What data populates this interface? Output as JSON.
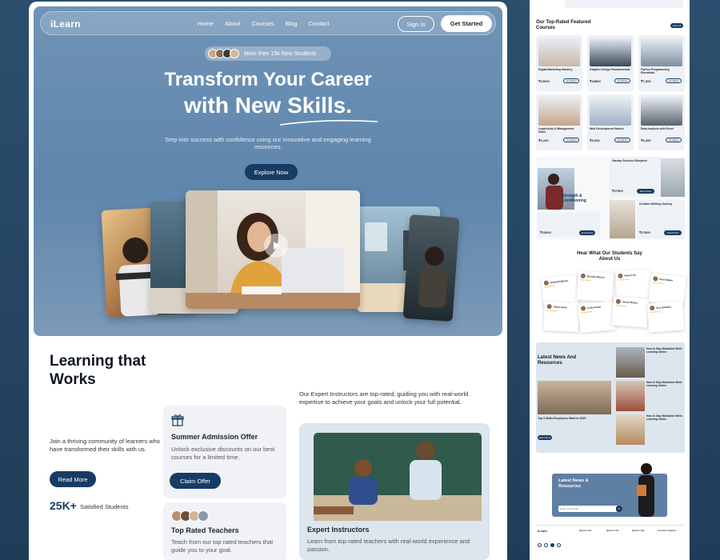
{
  "nav": {
    "logo": "iLearn",
    "links": [
      "Home",
      "About",
      "Courses",
      "Blog",
      "Contact"
    ],
    "sign_in": "Sign In",
    "get_started": "Get Started"
  },
  "hero": {
    "badge": "More then 15k New Students",
    "title_line1": "Transform Your Career",
    "title_line2": "with New Skills.",
    "subtitle": "Step into success with confidence using our innovative and engaging learning resources.",
    "cta": "Explore Now"
  },
  "works": {
    "title": "Learning that Works",
    "description": "Join a thriving community of learners who have transformed their skills with us.",
    "read_more": "Read More",
    "stat_value": "25K+",
    "stat_label": "Satisfied Students",
    "offer": {
      "title": "Summer Admission Offer",
      "text": "Unlock exclusive discounts on our best courses for a limited time.",
      "button": "Claim Offer"
    },
    "teachers": {
      "title": "Top Rated Teachers",
      "text": "Teach from our top rated teachers that guide you to your goal."
    },
    "instructors_desc": "Our Expert Instructors are top-rated, guiding you with real-world expertise to achieve your goals and unlock your full potential.",
    "instructors": {
      "title": "Expert Instructors",
      "text": "Learn from top-rated teachers with real-world experience and passion."
    }
  },
  "side": {
    "featured_title": "Our Top-Rated Featured Courses",
    "view_all": "View All",
    "courses": [
      {
        "title": "Digital Marketing Mastery",
        "price": "₹10000"
      },
      {
        "title": "Graphic Design Fundamentals",
        "price": "₹18500"
      },
      {
        "title": "Python Programming Essentials",
        "price": "₹7,000"
      },
      {
        "title": "Leadership & Management Skills",
        "price": "₹9,100"
      },
      {
        "title": "Web Development Basics",
        "price": "₹9,000"
      },
      {
        "title": "Data Analysis with Excel",
        "price": "₹6,300"
      }
    ],
    "course_btn": "Get Started",
    "strength_title": "Strength & Conditioning",
    "strength_price": "₹10000",
    "startup_title": "Startup Success Blueprint",
    "startup_price": "₹27500",
    "creative_title": "Creative Writing Journey",
    "creative_price": "₹27500",
    "enroll": "Enroll Now",
    "testimonials_title": "Hear What Our Students Say About Us",
    "testimonial_names": [
      "Kenneth Wilson",
      "Brenda Watson",
      "Robert Ho",
      "Paul Walker",
      "Alison Ross",
      "Cody Fisher",
      "Jenny Wilson",
      "Guy Hawkins"
    ],
    "news_title": "Latest News And Resources",
    "news_items": [
      "How to Stay Motivated While Learning Online",
      "How to Stay Motivated While Learning Online",
      "How to Stay Motivated While Learning Online"
    ],
    "news_feature": "Top 5 Skills Employers Want in 2025",
    "read_more": "Read More",
    "newsletter_title": "Latest News & Resources",
    "newsletter_placeholder": "Enter your Email",
    "footer_logo": "iLearn",
    "footer_cols": [
      "Quick Link",
      "Quick Link",
      "Quick Link",
      "Contact Support"
    ]
  },
  "colors": {
    "primary": "#173c64",
    "hero_top": "#6f93b6",
    "hero_bottom": "#7c9ab8",
    "bg": "#1f3d58"
  }
}
